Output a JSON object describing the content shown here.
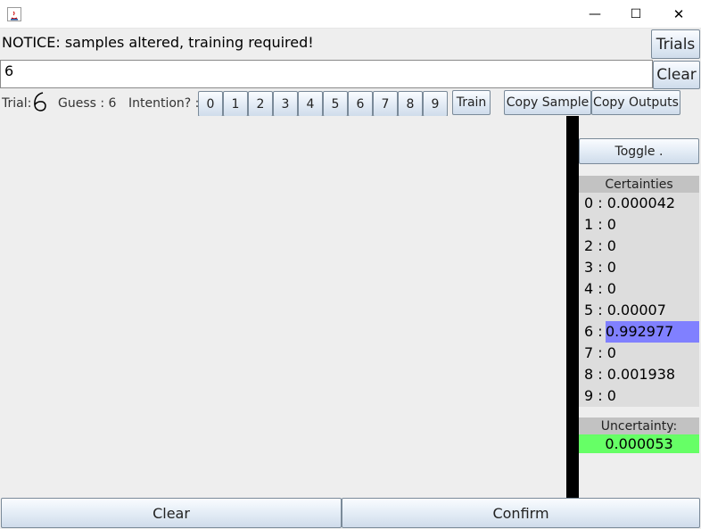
{
  "window": {
    "minimize_glyph": "—",
    "maximize_glyph": "☐",
    "close_glyph": "✕"
  },
  "notice": "NOTICE: samples altered, training required!",
  "buttons": {
    "trials": "Trials",
    "clear_top": "Clear",
    "train": "Train",
    "copy_sample": "Copy Sample",
    "copy_outputs": "Copy Outputs",
    "toggle": "Toggle .",
    "clear_bottom": "Clear",
    "confirm": "Confirm"
  },
  "input": {
    "value": "6"
  },
  "trial_row": {
    "trial_label": "Trial:",
    "trial_glyph": "6",
    "guess_label": "Guess : 6",
    "intention_label": "Intention? :",
    "digits": [
      "0",
      "1",
      "2",
      "3",
      "4",
      "5",
      "6",
      "7",
      "8",
      "9"
    ]
  },
  "certainties": {
    "header": "Certainties",
    "rows": [
      {
        "digit": "0",
        "value": "0.000042"
      },
      {
        "digit": "1",
        "value": "0"
      },
      {
        "digit": "2",
        "value": "0"
      },
      {
        "digit": "3",
        "value": "0"
      },
      {
        "digit": "4",
        "value": "0"
      },
      {
        "digit": "5",
        "value": "0.00007"
      },
      {
        "digit": "6",
        "value": "0.992977"
      },
      {
        "digit": "7",
        "value": "0"
      },
      {
        "digit": "8",
        "value": "0.001938"
      },
      {
        "digit": "9",
        "value": "0"
      }
    ],
    "highlight_color": "#8080ff"
  },
  "uncertainty": {
    "header": "Uncertainty:",
    "value": "0.000053",
    "color": "#66ff66"
  }
}
